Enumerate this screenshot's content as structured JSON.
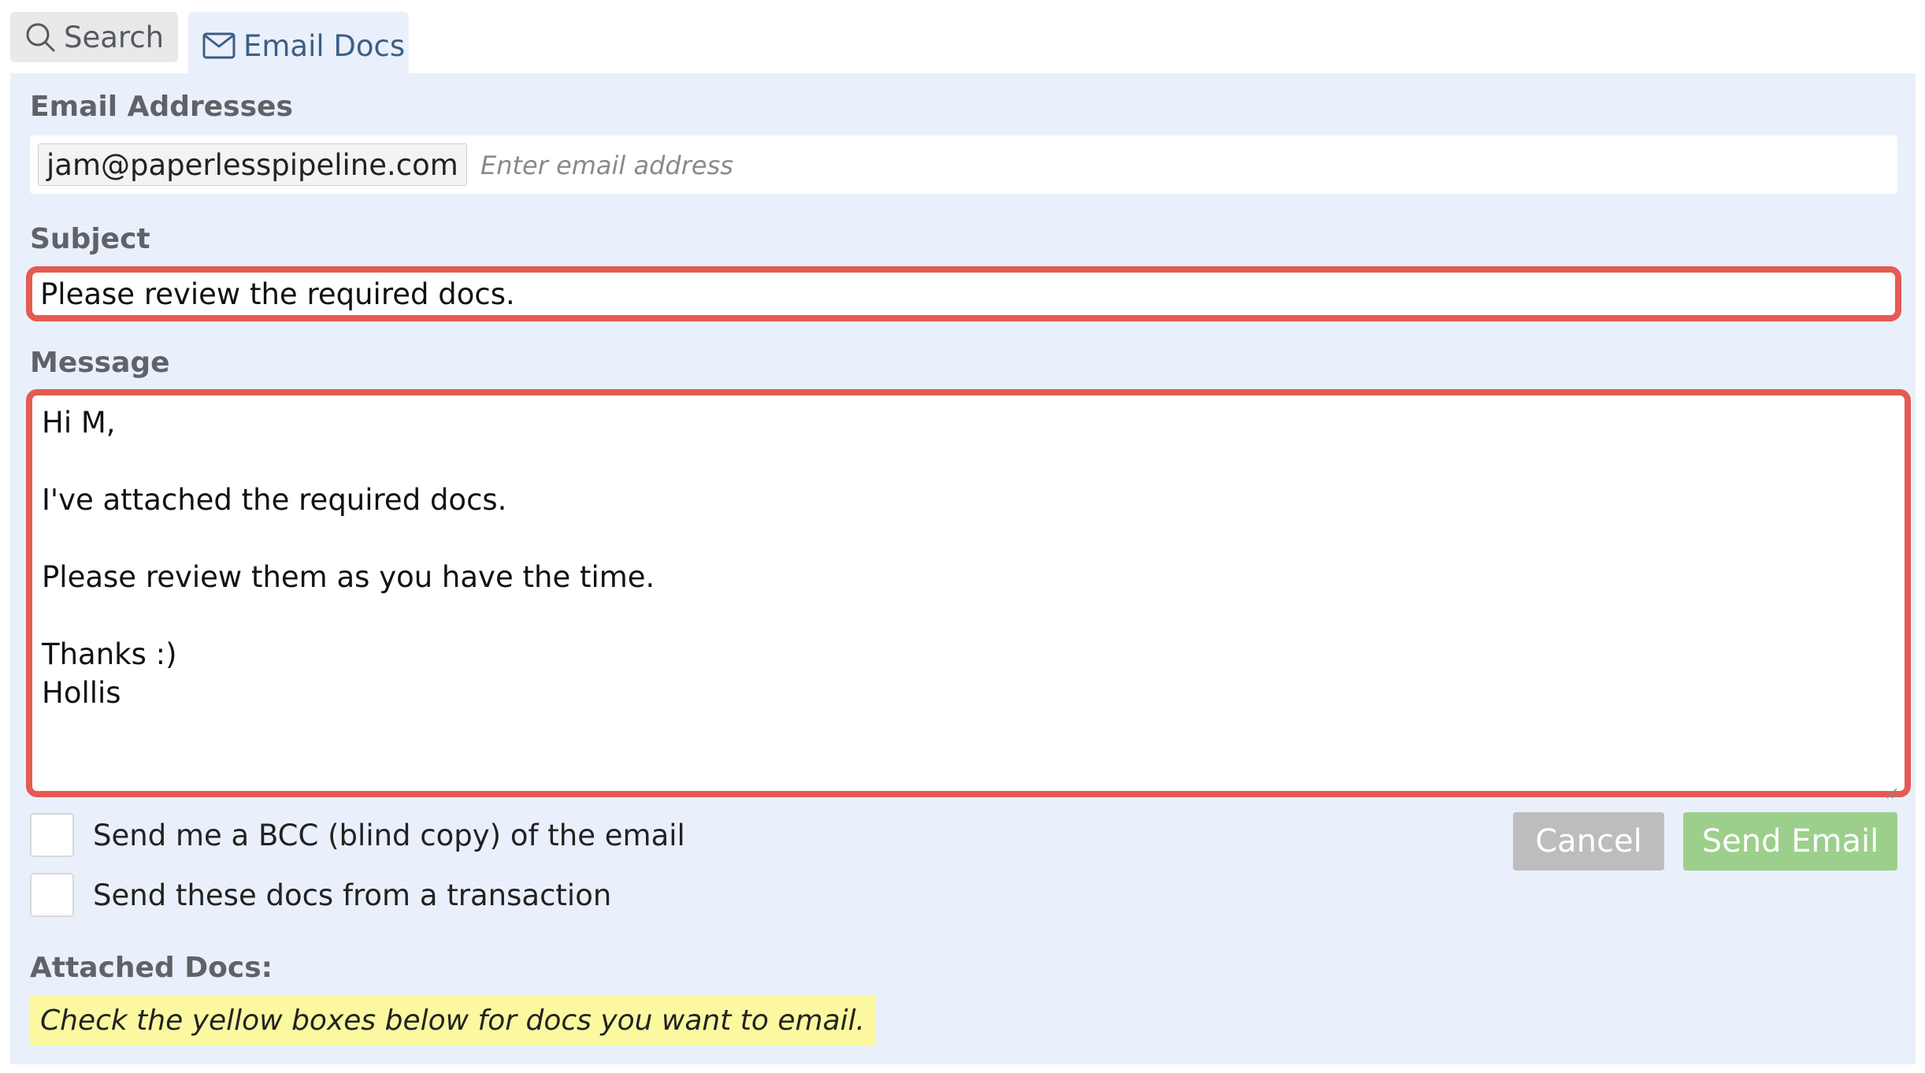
{
  "tabs": {
    "search": {
      "label": "Search",
      "icon": "search-icon"
    },
    "email_docs": {
      "label": "Email Docs",
      "icon": "mail-icon",
      "active": true
    }
  },
  "form": {
    "email_addresses": {
      "label": "Email Addresses",
      "chips": [
        "jam@paperlesspipeline.com"
      ],
      "placeholder": "Enter email address"
    },
    "subject": {
      "label": "Subject",
      "value": "Please review the required docs."
    },
    "message": {
      "label": "Message",
      "value": "Hi M,\n\nI've attached the required docs.\n\nPlease review them as you have the time.\n\nThanks :)\nHollis"
    },
    "options": {
      "bcc_label": "Send me a BCC (blind copy) of the email",
      "bcc_checked": false,
      "from_transaction_label": "Send these docs from a transaction",
      "from_transaction_checked": false
    },
    "buttons": {
      "cancel": "Cancel",
      "send": "Send Email"
    },
    "attached_docs": {
      "label": "Attached Docs:",
      "hint": "Check the yellow boxes below for docs you want to email."
    }
  },
  "colors": {
    "panel_bg": "#eaf0fb",
    "highlight_border": "#e55a52",
    "cancel_bg": "#bdbdbd",
    "send_bg": "#9ccf8c",
    "hint_bg": "#fbf8a0"
  }
}
